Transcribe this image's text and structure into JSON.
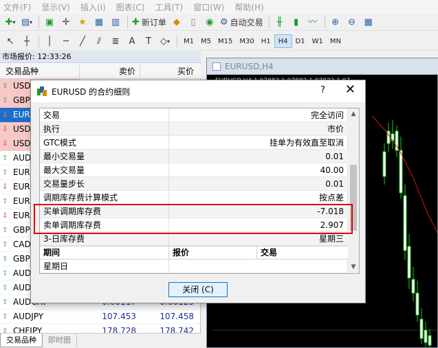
{
  "menu": [
    "文件(F)",
    "显示(V)",
    "插入(I)",
    "图表(C)",
    "工具(T)",
    "窗口(W)",
    "帮助(H)"
  ],
  "toolbar": {
    "new_order": "新订单",
    "auto_trading": "自动交易"
  },
  "timeframes": [
    "M1",
    "M5",
    "M15",
    "M30",
    "H1",
    "H4",
    "D1",
    "W1",
    "MN"
  ],
  "active_timeframe": "H4",
  "market_watch": {
    "title": "市场报价: 12:33:26",
    "col_symbol": "交易品种",
    "col_bid": "卖价",
    "col_ask": "买价",
    "rows": [
      {
        "symbol": "USD",
        "dir": "up",
        "bid": "",
        "ask": "",
        "style": "pink"
      },
      {
        "symbol": "GBP",
        "dir": "up",
        "bid": "",
        "ask": "",
        "style": "pink"
      },
      {
        "symbol": "EUR",
        "dir": "down",
        "bid": "",
        "ask": "",
        "style": "sel"
      },
      {
        "symbol": "USD",
        "dir": "down",
        "bid": "",
        "ask": "",
        "style": "pink"
      },
      {
        "symbol": "USD",
        "dir": "down",
        "bid": "",
        "ask": "",
        "style": "pink"
      },
      {
        "symbol": "AUD",
        "dir": "up",
        "bid": "",
        "ask": "",
        "style": ""
      },
      {
        "symbol": "EUR",
        "dir": "up",
        "bid": "",
        "ask": "",
        "style": ""
      },
      {
        "symbol": "EUR",
        "dir": "down",
        "bid": "",
        "ask": "",
        "style": ""
      },
      {
        "symbol": "EUR",
        "dir": "up",
        "bid": "",
        "ask": "",
        "style": ""
      },
      {
        "symbol": "EUR",
        "dir": "down",
        "bid": "",
        "ask": "",
        "style": ""
      },
      {
        "symbol": "GBP",
        "dir": "up",
        "bid": "",
        "ask": "",
        "style": ""
      },
      {
        "symbol": "CAD",
        "dir": "up",
        "bid": "",
        "ask": "",
        "style": ""
      },
      {
        "symbol": "GBP",
        "dir": "up",
        "bid": "",
        "ask": "",
        "style": ""
      },
      {
        "symbol": "AUD",
        "dir": "up",
        "bid": "",
        "ask": "",
        "style": ""
      },
      {
        "symbol": "AUD",
        "dir": "up",
        "bid": "",
        "ask": "",
        "style": ""
      },
      {
        "symbol": "AUDCHF",
        "dir": "up",
        "bid": "0.60117",
        "ask": "0.60125",
        "style": ""
      },
      {
        "symbol": "AUDJPY",
        "dir": "up",
        "bid": "107.453",
        "ask": "107.458",
        "style": ""
      },
      {
        "symbol": "CHFJPY",
        "dir": "up",
        "bid": "178.728",
        "ask": "178.742",
        "style": ""
      }
    ],
    "tabs": [
      "交易品种",
      "即时图"
    ],
    "active_tab": "交易品种"
  },
  "chart": {
    "title": "EURUSD,H4",
    "info": "EURUSD,H4 1.07882 1.07882 1.07822 1.07..."
  },
  "dialog": {
    "title": "EURUSD 的合约细则",
    "help": "?",
    "close": "✕",
    "rows": [
      {
        "k": "交易",
        "v": "完全访问"
      },
      {
        "k": "执行",
        "v": "市价"
      },
      {
        "k": "GTC模式",
        "v": "挂单为有效直至取消"
      },
      {
        "k": "最小交易量",
        "v": "0.01"
      },
      {
        "k": "最大交易量",
        "v": "40.00"
      },
      {
        "k": "交易量步长",
        "v": "0.01"
      },
      {
        "k": "调期库存费计算模式",
        "v": "按点差"
      },
      {
        "k": "买单调期库存费",
        "v": "-7.018"
      },
      {
        "k": "卖单调期库存费",
        "v": "2.907"
      },
      {
        "k": "3-日库存费",
        "v": "星期三"
      }
    ],
    "table_header": {
      "c1": "期间",
      "c2": "报价",
      "c3": "交易"
    },
    "table_rows": [
      {
        "k": "星期日"
      }
    ],
    "close_button": "关闭 (C)"
  },
  "colors": {
    "bull": "#22c722",
    "bear": "#e02020",
    "ma": "#d01818",
    "highlight": "#e00000"
  }
}
